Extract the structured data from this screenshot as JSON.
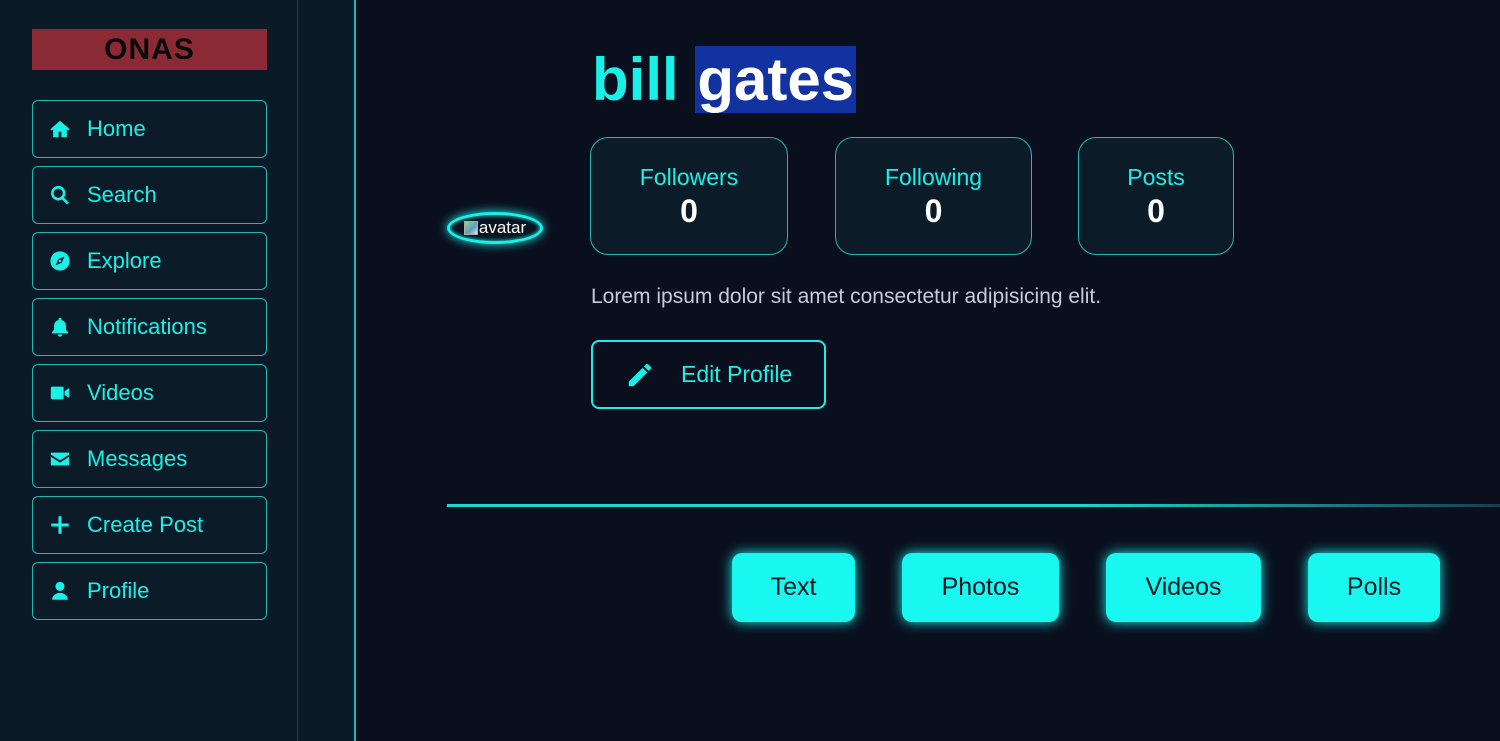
{
  "brand": {
    "logo": "ONAS"
  },
  "sidebar": {
    "items": [
      {
        "label": "Home",
        "icon": "home-icon"
      },
      {
        "label": "Search",
        "icon": "search-icon"
      },
      {
        "label": "Explore",
        "icon": "compass-icon"
      },
      {
        "label": "Notifications",
        "icon": "bell-icon"
      },
      {
        "label": "Videos",
        "icon": "video-icon"
      },
      {
        "label": "Messages",
        "icon": "envelope-icon"
      },
      {
        "label": "Create Post",
        "icon": "plus-icon"
      },
      {
        "label": "Profile",
        "icon": "user-icon"
      }
    ]
  },
  "profile": {
    "avatar_alt": "avatar",
    "first_name": "bill",
    "last_name": "gates",
    "bio": "Lorem ipsum dolor sit amet consectetur adipisicing elit.",
    "edit_label": "Edit Profile",
    "stats": [
      {
        "label": "Followers",
        "value": "0"
      },
      {
        "label": "Following",
        "value": "0"
      },
      {
        "label": "Posts",
        "value": "0"
      }
    ]
  },
  "tabs": [
    {
      "label": "Text"
    },
    {
      "label": "Photos"
    },
    {
      "label": "Videos"
    },
    {
      "label": "Polls"
    }
  ],
  "colors": {
    "accent": "#19f0e8",
    "background": "#0a0f1e",
    "sidebar": "#0b1a26",
    "logo_bg": "#8b2a35",
    "selection": "#1132a0"
  }
}
